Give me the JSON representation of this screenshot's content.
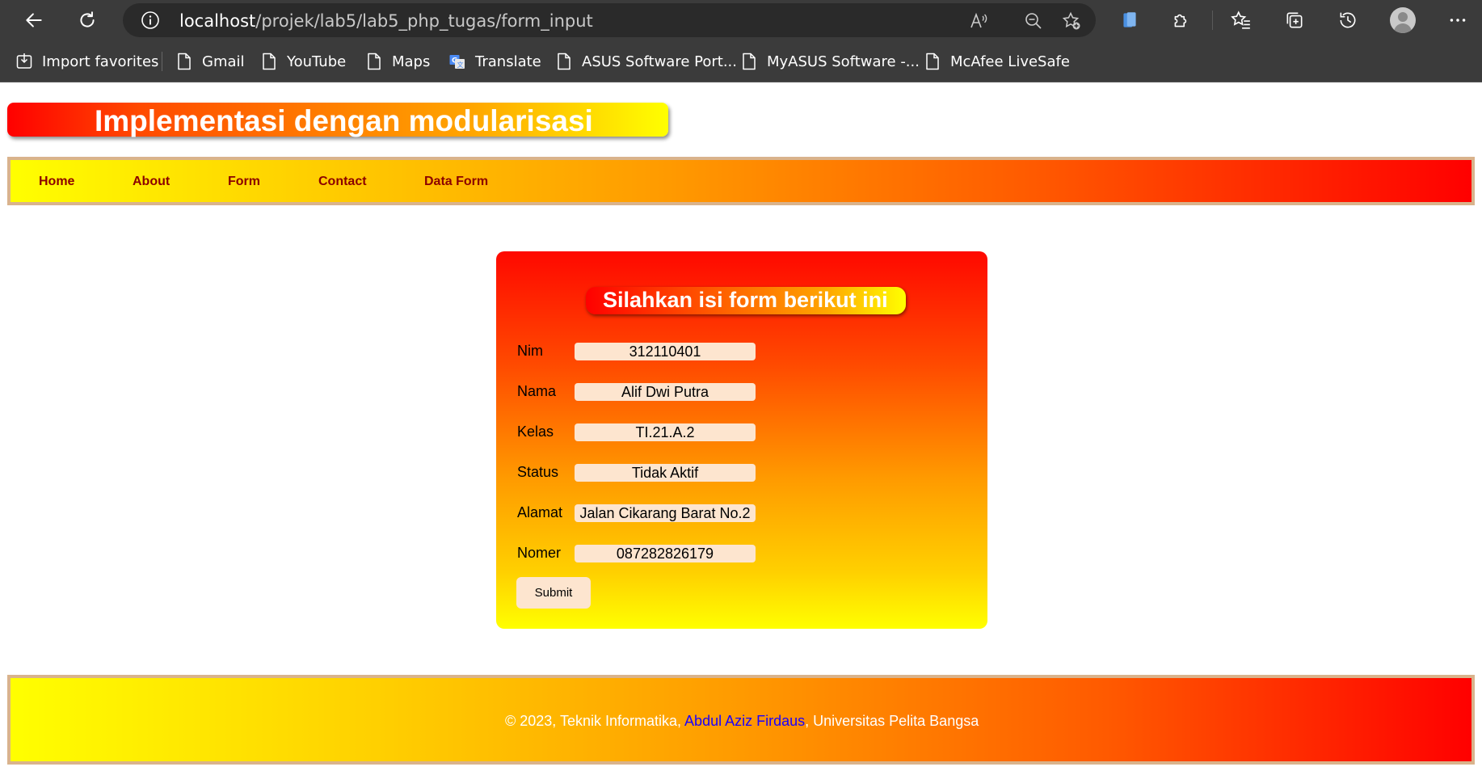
{
  "browser": {
    "url_host": "localhost",
    "url_path": "/projek/lab5/lab5_php_tugas/form_input",
    "favorites": [
      {
        "label": "Import favorites",
        "icon": "import-icon"
      },
      {
        "label": "Gmail",
        "icon": "page-icon"
      },
      {
        "label": "YouTube",
        "icon": "page-icon"
      },
      {
        "label": "Maps",
        "icon": "page-icon"
      },
      {
        "label": "Translate",
        "icon": "translate-icon"
      },
      {
        "label": "ASUS Software Port...",
        "icon": "page-icon"
      },
      {
        "label": "MyASUS Software -...",
        "icon": "page-icon"
      },
      {
        "label": "McAfee LiveSafe",
        "icon": "page-icon"
      }
    ]
  },
  "page": {
    "banner_title": "Implementasi dengan modularisasi",
    "nav": [
      "Home",
      "About",
      "Form",
      "Contact",
      "Data Form"
    ],
    "form": {
      "title": "Silahkan isi form berikut ini",
      "fields": [
        {
          "label": "Nim",
          "value": "312110401"
        },
        {
          "label": "Nama",
          "value": "Alif Dwi Putra"
        },
        {
          "label": "Kelas",
          "value": "TI.21.A.2"
        },
        {
          "label": "Status",
          "value": "Tidak Aktif"
        },
        {
          "label": "Alamat",
          "value": "Jalan Cikarang Barat No.2"
        },
        {
          "label": "Nomer",
          "value": "087282826179"
        }
      ],
      "submit_label": "Submit"
    },
    "footer": {
      "prefix": "© 2023, Teknik Informatika, ",
      "link": "Abdul Aziz Firdaus",
      "suffix": ", Universitas Pelita Bangsa"
    }
  },
  "colors": {
    "chrome_bg": "#3b3b3b",
    "nav_text": "#8b0000",
    "input_bg": "#fde5cf",
    "link": "#1a00ff",
    "border": "#d9b38c"
  }
}
